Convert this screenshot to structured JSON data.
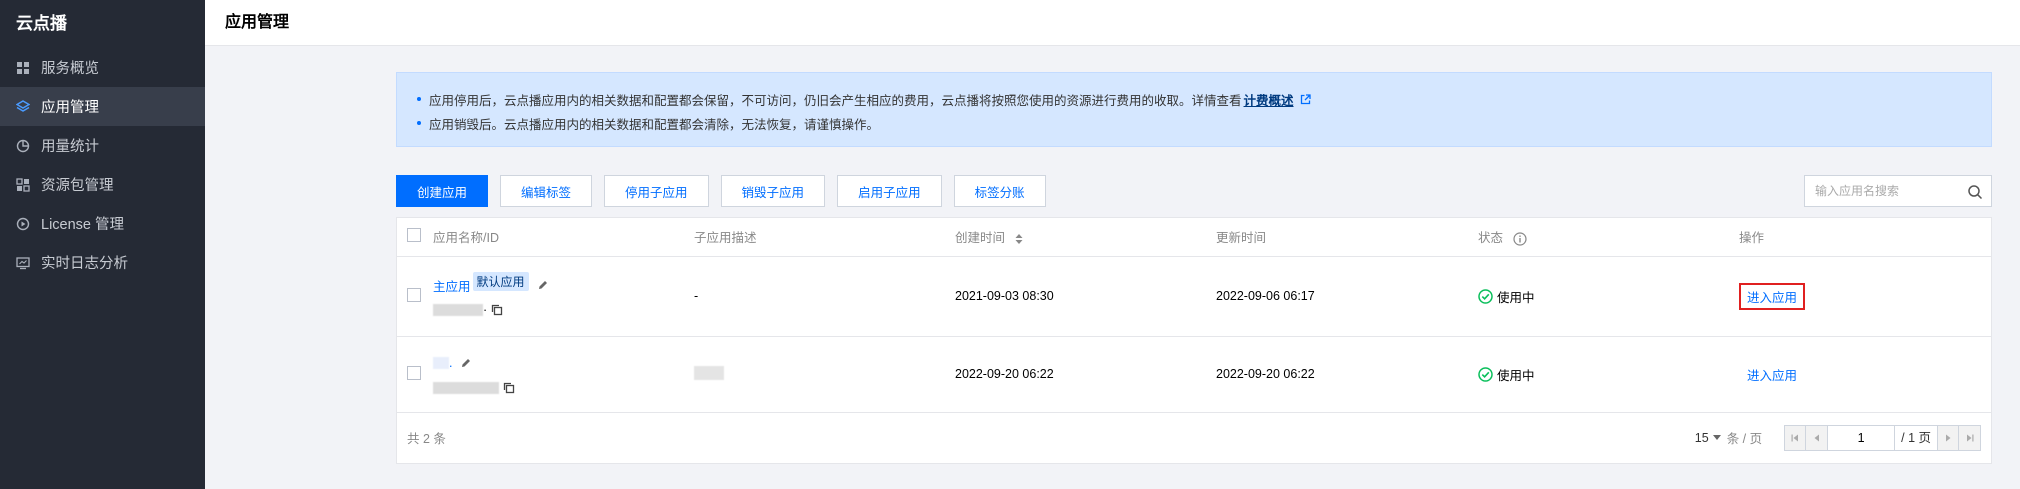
{
  "sidebar": {
    "brand": "云点播",
    "items": [
      {
        "label": "服务概览",
        "icon": "grid-icon"
      },
      {
        "label": "应用管理",
        "icon": "layers-icon",
        "active": true
      },
      {
        "label": "用量统计",
        "icon": "pie-chart-icon"
      },
      {
        "label": "资源包管理",
        "icon": "package-grid-icon"
      },
      {
        "label": "License 管理",
        "icon": "license-play-icon"
      },
      {
        "label": "实时日志分析",
        "icon": "monitor-icon"
      }
    ]
  },
  "header": {
    "title": "应用管理"
  },
  "notice": {
    "line1": "应用停用后，云点播应用内的相关数据和配置都会保留，不可访问，仍旧会产生相应的费用，云点播将按照您使用的资源进行费用的收取。详情查看",
    "line1_link": "计费概述",
    "line2": "应用销毁后。云点播应用内的相关数据和配置都会清除，无法恢复，请谨慎操作。"
  },
  "toolbar": {
    "create": "创建应用",
    "edit_tags": "编辑标签",
    "disable_sub": "停用子应用",
    "destroy_sub": "销毁子应用",
    "enable_sub": "启用子应用",
    "tag_billing": "标签分账",
    "search_placeholder": "输入应用名搜索"
  },
  "table": {
    "columns": {
      "name": "应用名称/ID",
      "desc": "子应用描述",
      "created": "创建时间",
      "updated": "更新时间",
      "status": "状态",
      "action": "操作"
    },
    "rows": [
      {
        "name": "主应用",
        "tag": "默认应用",
        "id_suffix": "·",
        "desc": "-",
        "created": "2021-09-03 08:30",
        "updated": "2022-09-06 06:17",
        "status": "使用中",
        "action": "进入应用"
      },
      {
        "name": ".",
        "desc": "",
        "created": "2022-09-20 06:22",
        "updated": "2022-09-20 06:22",
        "status": "使用中",
        "action": "进入应用"
      }
    ]
  },
  "footer": {
    "total": "共 2 条",
    "per_page": "15",
    "per_page_unit": "条 / 页",
    "page": "1",
    "page_total": "/ 1 页"
  },
  "colors": {
    "sidebar_bg": "#252a35",
    "accent": "#006eff",
    "status_ok": "#0abf5b",
    "highlight": "#e02020"
  }
}
